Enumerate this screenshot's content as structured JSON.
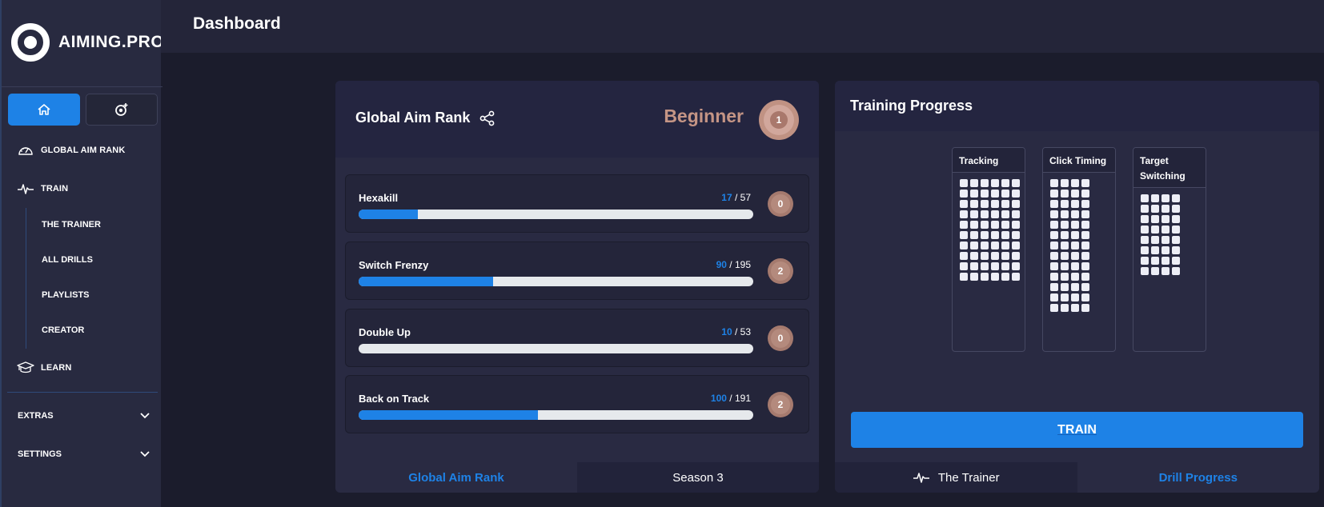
{
  "app": {
    "brand": "AIMING.PRO"
  },
  "header": {
    "title": "Dashboard"
  },
  "sidebar": {
    "top_buttons": [
      {
        "icon": "home-icon",
        "active": true
      },
      {
        "icon": "target-plus-icon",
        "active": false
      }
    ],
    "items": [
      {
        "label": "GLOBAL AIM RANK",
        "icon": "gauge-icon"
      },
      {
        "label": "TRAIN",
        "icon": "pulse-icon"
      },
      {
        "label": "LEARN",
        "icon": "graduation-cap-icon"
      }
    ],
    "train_subitems": [
      "THE TRAINER",
      "ALL DRILLS",
      "PLAYLISTS",
      "CREATOR"
    ],
    "sections": [
      {
        "label": "EXTRAS",
        "icon": "chevron-down-icon"
      },
      {
        "label": "SETTINGS",
        "icon": "chevron-down-icon"
      }
    ]
  },
  "rank_panel": {
    "title": "Global Aim Rank",
    "share_icon": "share-icon",
    "rank_name": "Beginner",
    "rank_level": "1",
    "drills": [
      {
        "name": "Hexakill",
        "current": "17",
        "total": "57",
        "progress": 0.15,
        "badge": "0"
      },
      {
        "name": "Switch Frenzy",
        "current": "90",
        "total": "195",
        "progress": 0.34,
        "badge": "2"
      },
      {
        "name": "Double Up",
        "current": "10",
        "total": "53",
        "progress": 0.0,
        "badge": "0"
      },
      {
        "name": "Back on Track",
        "current": "100",
        "total": "191",
        "progress": 0.455,
        "badge": "2"
      }
    ],
    "tabs": [
      {
        "label": "Global Aim Rank",
        "active": true
      },
      {
        "label": "Season 3",
        "active": false
      }
    ]
  },
  "progress_panel": {
    "title": "Training Progress",
    "categories": [
      {
        "label": "Tracking",
        "columns": 6,
        "rows": 10
      },
      {
        "label": "Click Timing",
        "columns": 4,
        "rows": 13
      },
      {
        "label": "Target Switching",
        "columns": 4,
        "rows": 8
      }
    ],
    "train_button": "TRAIN",
    "tabs": [
      {
        "label": "The Trainer",
        "icon": "pulse-icon",
        "active": false
      },
      {
        "label": "Drill Progress",
        "active": true
      }
    ]
  },
  "colors": {
    "accent": "#1e82e6",
    "rank": "#c59585"
  }
}
